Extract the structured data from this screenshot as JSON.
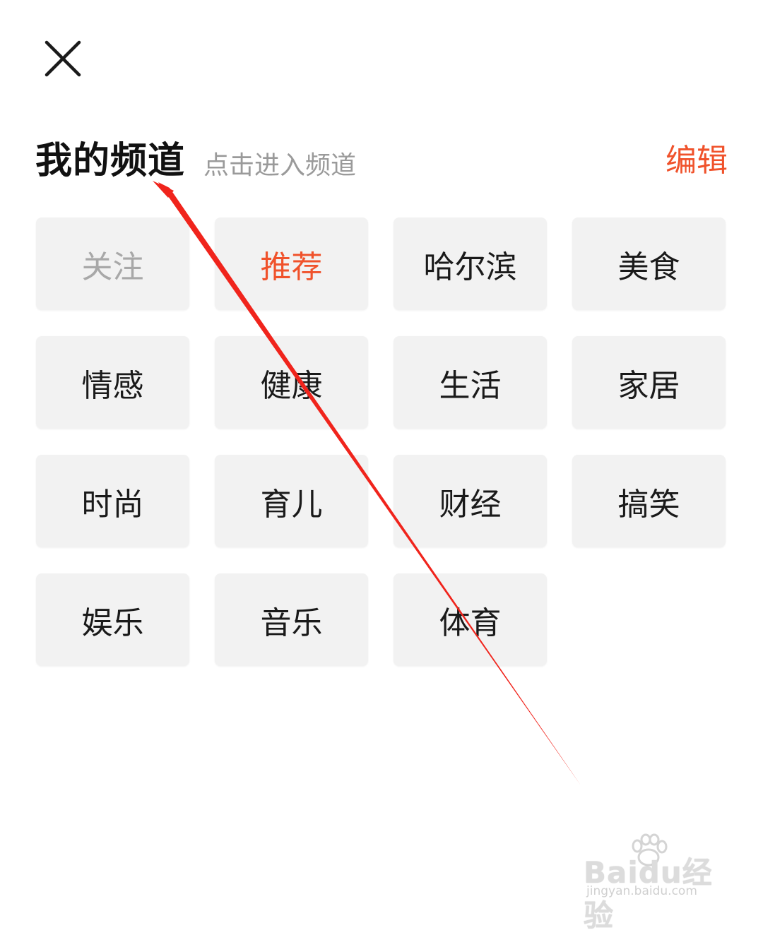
{
  "header": {
    "title": "我的频道",
    "subtitle": "点击进入频道",
    "edit_label": "编辑"
  },
  "channels": [
    {
      "label": "关注",
      "state": "disabled"
    },
    {
      "label": "推荐",
      "state": "active"
    },
    {
      "label": "哈尔滨",
      "state": "normal"
    },
    {
      "label": "美食",
      "state": "normal"
    },
    {
      "label": "情感",
      "state": "normal"
    },
    {
      "label": "健康",
      "state": "normal"
    },
    {
      "label": "生活",
      "state": "normal"
    },
    {
      "label": "家居",
      "state": "normal"
    },
    {
      "label": "时尚",
      "state": "normal"
    },
    {
      "label": "育儿",
      "state": "normal"
    },
    {
      "label": "财经",
      "state": "normal"
    },
    {
      "label": "搞笑",
      "state": "normal"
    },
    {
      "label": "娱乐",
      "state": "normal"
    },
    {
      "label": "音乐",
      "state": "normal"
    },
    {
      "label": "体育",
      "state": "normal"
    }
  ],
  "watermark": {
    "brand": "Baidu经验",
    "url": "jingyan.baidu.com"
  },
  "colors": {
    "accent": "#f0522b",
    "chip_bg": "#f2f2f2",
    "disabled_text": "#a8a8a8",
    "subtitle_text": "#9a9a9a",
    "annotation_arrow": "#f0241c"
  },
  "icons": {
    "close": "close-icon",
    "annotation": "red-arrow-annotation",
    "watermark_logo": "paw-icon"
  }
}
